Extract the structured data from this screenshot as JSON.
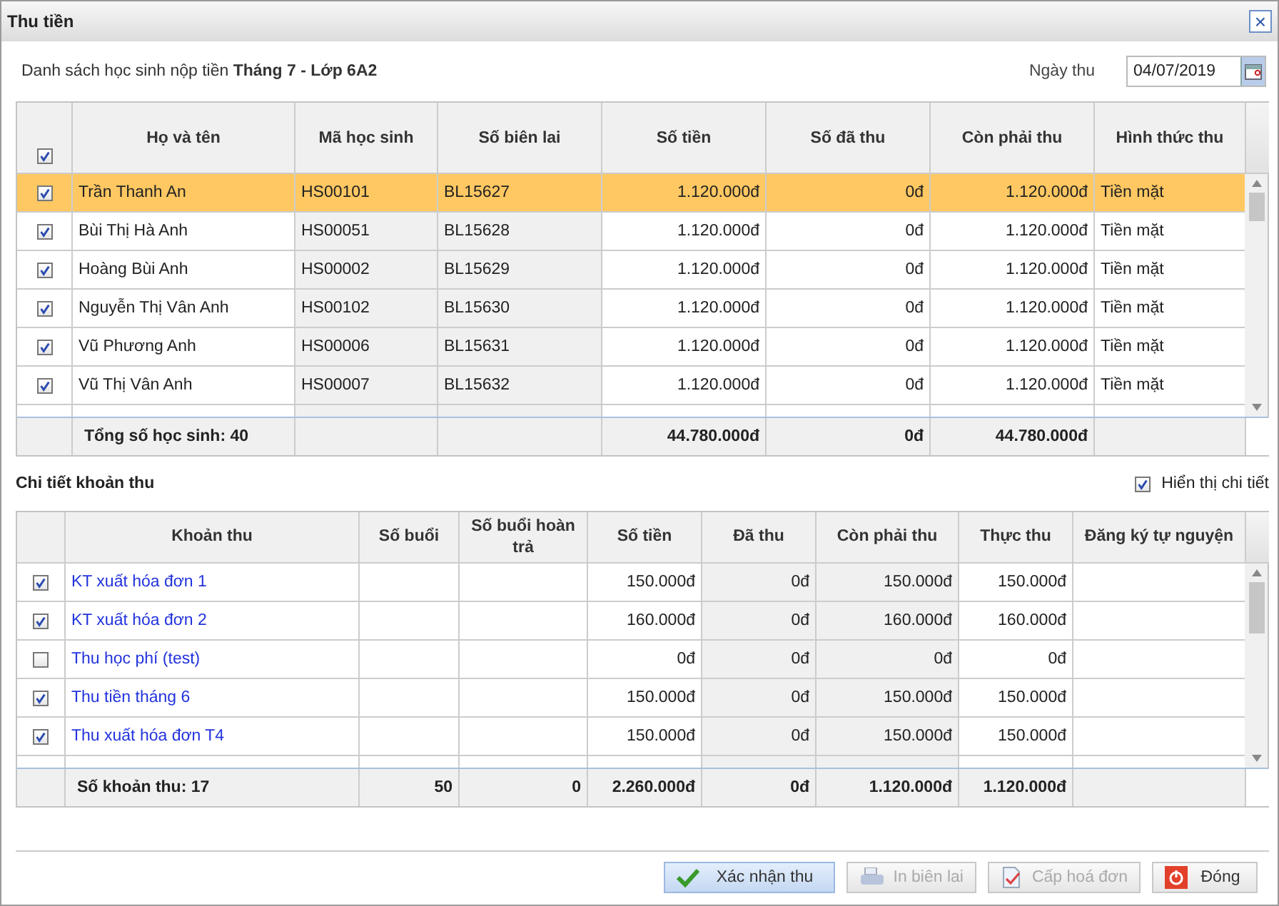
{
  "window": {
    "title": "Thu tiền",
    "close": "×"
  },
  "student_list": {
    "caption": "Danh sách học sinh nộp tiền **Tháng 7 - Lớp 6A2**",
    "date_label": "Ngày thu",
    "date_value": "04/07/2019",
    "all_checked": true,
    "columns": [
      "Họ và tên",
      "Mã học sinh",
      "Số biên lai",
      "Số tiền",
      "Số đã thu",
      "Còn phải thu",
      "Hình thức thu"
    ],
    "rows": [
      {
        "checked": true,
        "selected": true,
        "cells": [
          "Trần Thanh An",
          "HS00101",
          "BL15627",
          "1.120.000đ",
          "0đ",
          "1.120.000đ",
          "Tiền mặt"
        ]
      },
      {
        "checked": true,
        "selected": false,
        "cells": [
          "Bùi Thị Hà Anh",
          "HS00051",
          "BL15628",
          "1.120.000đ",
          "0đ",
          "1.120.000đ",
          "Tiền mặt"
        ]
      },
      {
        "checked": true,
        "selected": false,
        "cells": [
          "Hoàng Bùi Anh",
          "HS00002",
          "BL15629",
          "1.120.000đ",
          "0đ",
          "1.120.000đ",
          "Tiền mặt"
        ]
      },
      {
        "checked": true,
        "selected": false,
        "cells": [
          "Nguyễn Thị Vân Anh",
          "HS00102",
          "BL15630",
          "1.120.000đ",
          "0đ",
          "1.120.000đ",
          "Tiền mặt"
        ]
      },
      {
        "checked": true,
        "selected": false,
        "cells": [
          "Vũ Phương Anh",
          "HS00006",
          "BL15631",
          "1.120.000đ",
          "0đ",
          "1.120.000đ",
          "Tiền mặt"
        ]
      },
      {
        "checked": true,
        "selected": false,
        "cells": [
          "Vũ Thị Vân Anh",
          "HS00007",
          "BL15632",
          "1.120.000đ",
          "0đ",
          "1.120.000đ",
          "Tiền mặt"
        ]
      }
    ],
    "footer": {
      "total_label": "Tổng số học sinh: 40",
      "amount": "44.780.000đ",
      "paid": "0đ",
      "remaining": "44.780.000đ"
    }
  },
  "fee_details": {
    "title": "Chi tiết khoản thu",
    "show_detail": {
      "label": "Hiển thị chi tiết",
      "checked": true
    },
    "columns": [
      "Khoản thu",
      "Số buổi",
      "Số buổi hoàn trả",
      "Số tiền",
      "Đã thu",
      "Còn phải thu",
      "Thực thu",
      "Đăng ký tự nguyện"
    ],
    "rows": [
      {
        "checked": true,
        "cells": [
          "KT xuất hóa đơn 1",
          "",
          "",
          "150.000đ",
          "0đ",
          "150.000đ",
          "150.000đ",
          ""
        ]
      },
      {
        "checked": true,
        "cells": [
          "KT xuất hóa đơn 2",
          "",
          "",
          "160.000đ",
          "0đ",
          "160.000đ",
          "160.000đ",
          ""
        ]
      },
      {
        "checked": false,
        "cells": [
          "Thu học phí (test)",
          "",
          "",
          "0đ",
          "0đ",
          "0đ",
          "0đ",
          ""
        ]
      },
      {
        "checked": true,
        "cells": [
          "Thu tiền tháng 6",
          "",
          "",
          "150.000đ",
          "0đ",
          "150.000đ",
          "150.000đ",
          ""
        ]
      },
      {
        "checked": true,
        "cells": [
          "Thu xuất hóa đơn T4",
          "",
          "",
          "150.000đ",
          "0đ",
          "150.000đ",
          "150.000đ",
          ""
        ]
      }
    ],
    "footer": {
      "total_label": "Số khoản thu: 17",
      "sessions": "50",
      "refunded_sessions": "0",
      "amount": "2.260.000đ",
      "paid": "0đ",
      "remaining": "1.120.000đ",
      "actual": "1.120.000đ"
    }
  },
  "buttons": [
    {
      "label": "Xác nhận thu",
      "kind": "confirm",
      "disabled": false,
      "primary": true
    },
    {
      "label": "In biên lai",
      "kind": "print",
      "disabled": true,
      "primary": false
    },
    {
      "label": "Cấp hoá đơn",
      "kind": "invoice",
      "disabled": true,
      "primary": false
    },
    {
      "label": "Đóng",
      "kind": "close",
      "disabled": false,
      "primary": false
    }
  ]
}
